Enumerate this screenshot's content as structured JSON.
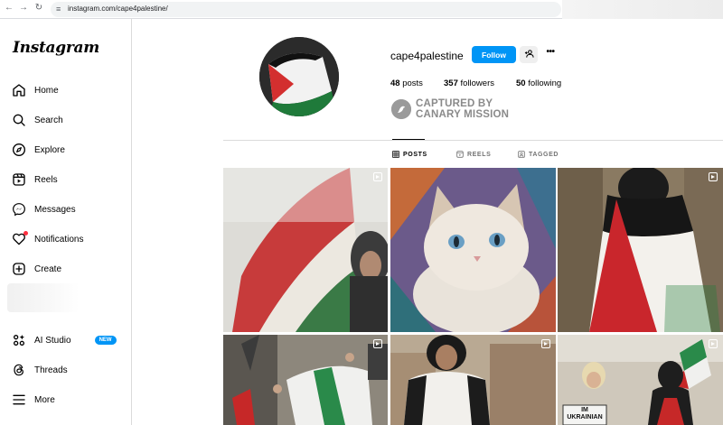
{
  "browser": {
    "url": "instagram.com/cape4palestine/"
  },
  "sidebar": {
    "logo": "Instagram",
    "items": [
      {
        "label": "Home",
        "icon": "home-icon"
      },
      {
        "label": "Search",
        "icon": "search-icon"
      },
      {
        "label": "Explore",
        "icon": "compass-icon"
      },
      {
        "label": "Reels",
        "icon": "reels-icon"
      },
      {
        "label": "Messages",
        "icon": "messenger-icon"
      },
      {
        "label": "Notifications",
        "icon": "heart-icon"
      },
      {
        "label": "Create",
        "icon": "plus-square-icon"
      },
      {
        "label": "AI Studio",
        "icon": "ai-studio-icon",
        "badge": "NEW"
      },
      {
        "label": "Threads",
        "icon": "threads-icon"
      },
      {
        "label": "More",
        "icon": "hamburger-icon"
      }
    ]
  },
  "profile": {
    "username": "cape4palestine",
    "follow_label": "Follow",
    "stats": {
      "posts_count": "48",
      "posts_label": "posts",
      "followers_count": "357",
      "followers_label": "followers",
      "following_count": "50",
      "following_label": "following"
    }
  },
  "watermark": {
    "line1": "CAPTURED BY",
    "line2": "CANARY MISSION"
  },
  "tabs": [
    {
      "label": "POSTS",
      "active": true
    },
    {
      "label": "REELS",
      "active": false
    },
    {
      "label": "TAGGED",
      "active": false
    }
  ],
  "posts": [
    {
      "subject": "woman-holding-palestinian-flag-smoke",
      "is_reel": true
    },
    {
      "subject": "siamese-kitten-on-embroidered-fabric",
      "is_reel": false
    },
    {
      "subject": "person-wearing-palestinian-flag-cape",
      "is_reel": true
    },
    {
      "subject": "protest-crowd-with-flags",
      "is_reel": true
    },
    {
      "subject": "woman-with-flag-city-hall",
      "is_reel": true
    },
    {
      "subject": "rally-with-im-ukrainian-sign",
      "is_reel": true
    }
  ],
  "post_sign_text": "IM UKRAINIAN",
  "colors": {
    "accent": "#0095f6",
    "notification_dot": "#ff3040",
    "flag_red": "#d32f2f",
    "flag_green": "#1f7a3a"
  }
}
